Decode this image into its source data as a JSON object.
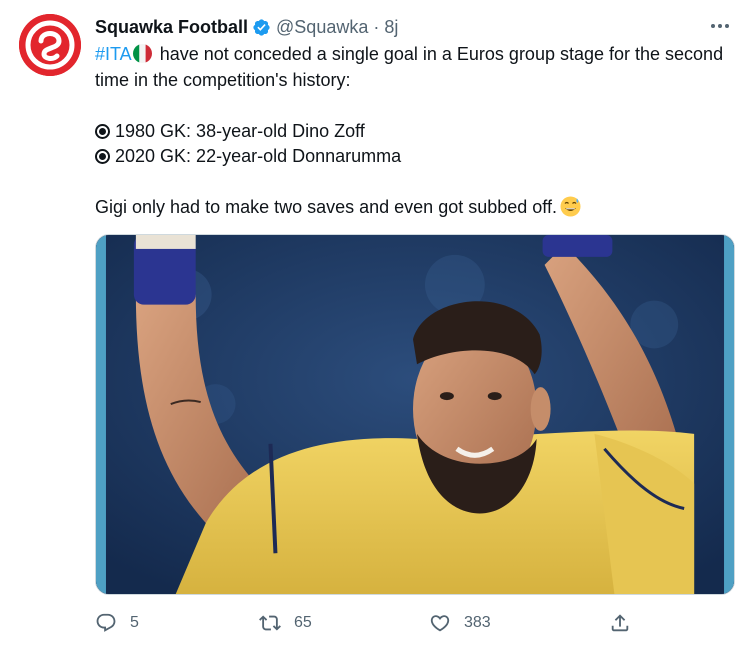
{
  "tweet": {
    "display_name": "Squawka Football",
    "handle": "@Squawka",
    "separator": "·",
    "time": "8j",
    "hashtag": "#ITA",
    "line1_rest": " have not conceded a single goal in a Euros group stage for the second time in the competition's history:",
    "bullet1": "1980 GK: 38-year-old Dino Zoff",
    "bullet2": "2020 GK: 22-year-old Donnarumma",
    "closing": "Gigi only had to make two saves and even got subbed off."
  },
  "actions": {
    "replies": "5",
    "retweets": "65",
    "likes": "383"
  },
  "colors": {
    "brand_red": "#e2262d",
    "verified_blue": "#1d9bf0",
    "link_blue": "#1d9bf0",
    "muted_grey": "#536471"
  },
  "icons": [
    "verified-badge-icon",
    "more-options-icon",
    "italy-flag-icon",
    "grinning-sweat-emoji-icon",
    "reply-icon",
    "retweet-icon",
    "like-icon",
    "share-icon"
  ]
}
